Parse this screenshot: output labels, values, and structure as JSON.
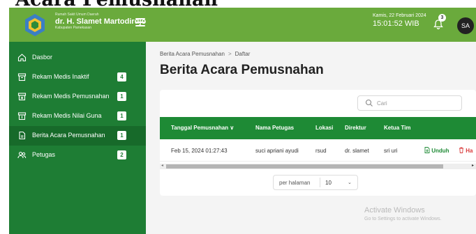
{
  "page_heading": "Acara Pemusnahan",
  "topbar": {
    "brand_small": "Rumah Sakit Umum Daerah",
    "brand_name": "dr. H. Slamet Martodirdjo",
    "brand_sub": "Kabupaten Pamekasan",
    "date": "Kamis, 22 Februari 2024",
    "time": "15:01:52 WIB",
    "notif_count": "3",
    "avatar_initials": "SA"
  },
  "sidebar": {
    "items": [
      {
        "label": "Dasbor",
        "badge": "",
        "icon": "home-icon"
      },
      {
        "label": "Rekam Medis Inaktif",
        "badge": "4",
        "icon": "archive-icon"
      },
      {
        "label": "Rekam Medis Pemusnahan",
        "badge": "1",
        "icon": "archive-x-icon"
      },
      {
        "label": "Rekam Medis Nilai Guna",
        "badge": "1",
        "icon": "archive-check-icon"
      },
      {
        "label": "Berita Acara Pemusnahan",
        "badge": "1",
        "icon": "document-icon"
      },
      {
        "label": "Petugas",
        "badge": "2",
        "icon": "users-icon"
      }
    ]
  },
  "breadcrumb": {
    "parent": "Berita Acara Pemusnahan",
    "sep": ">",
    "current": "Daftar"
  },
  "title": "Berita Acara Pemusnahan",
  "search": {
    "placeholder": "Cari"
  },
  "table": {
    "columns": [
      "Tanggal Pemusnahan",
      "Nama Petugas",
      "Lokasi",
      "Direktur",
      "Ketua Tim"
    ],
    "sort_indicator": "∨",
    "rows": [
      {
        "tanggal": "Feb 15, 2024 01:27:43",
        "nama": "suci apriani ayudi",
        "lokasi": "rsud",
        "direktur": "dr. slamet",
        "ketua": "sri uri",
        "unduh": "Unduh",
        "hapus": "Ha"
      }
    ]
  },
  "pagination": {
    "label": "per halaman",
    "value": "10"
  },
  "watermark": {
    "line1": "Activate Windows",
    "line2": "Go to Settings to activate Windows."
  },
  "colors": {
    "topbar": "#6aaa3c",
    "sidebar": "#1e7d34",
    "table_header": "#1e8a35",
    "danger": "#d93b3b"
  }
}
